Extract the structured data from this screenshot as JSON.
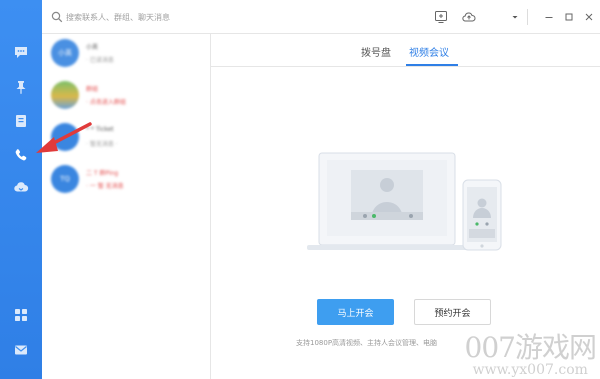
{
  "sidebar": {
    "icons": [
      "chat-bubble-icon",
      "pin-icon",
      "contacts-book-icon",
      "phone-icon",
      "cloud-icon",
      "apps-grid-icon",
      "mail-icon"
    ]
  },
  "topbar": {
    "search_placeholder": "搜索联系人、群组、聊天消息",
    "icons": [
      "screen-share-icon",
      "cloud-upload-icon",
      "dropdown-caret-icon",
      "minimize-icon",
      "maximize-icon",
      "close-icon"
    ]
  },
  "contacts": [
    {
      "avatar_text": "小英",
      "name": "小英",
      "msg": "· 已读消息",
      "avatar_color": "#4a90e2"
    },
    {
      "avatar_text": "",
      "name": "群组",
      "msg": "· 点击进入群组",
      "avatar_color": "#d9b84a"
    },
    {
      "avatar_text": "",
      "name": "* * Ticket",
      "msg": "· 暂无消息 ·",
      "avatar_color": "#3a86e0"
    },
    {
      "avatar_text": "TQ",
      "name": "二 T 群Ping",
      "msg": "· 一 暂 无消息",
      "avatar_color": "#3a86e0"
    }
  ],
  "tabs": [
    {
      "label": "拨号盘",
      "active": false
    },
    {
      "label": "视频会议",
      "active": true
    }
  ],
  "actions": {
    "start_now": "马上开会",
    "schedule": "预约开会"
  },
  "support_text": "支持1080P高清视频、主持人会议管理、电脑",
  "watermark": {
    "main": "007游戏网",
    "sub": "www.yx007.com"
  },
  "colors": {
    "accent": "#2f7fe6",
    "primary_button": "#3e9ef0",
    "annotation_arrow": "#e03a3a"
  }
}
